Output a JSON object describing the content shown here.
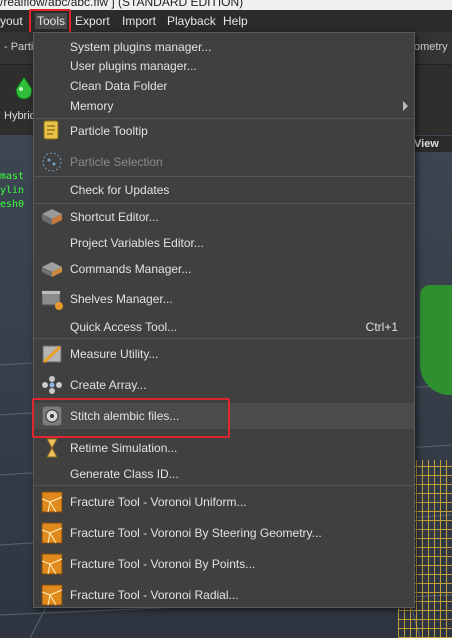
{
  "window": {
    "title": "/realflow/abc/abc.flw ] (STANDARD EDITION)"
  },
  "menubar": [
    {
      "label": "yout"
    },
    {
      "label": "Tools"
    },
    {
      "label": "Export"
    },
    {
      "label": "Import"
    },
    {
      "label": "Playback"
    },
    {
      "label": "Help"
    }
  ],
  "tabs": {
    "left": "- Parti",
    "right": "ometry"
  },
  "shelf": {
    "item": "Hybrid"
  },
  "viewport": {
    "label": "View"
  },
  "console": [
    "mast",
    "ylin",
    "esh0"
  ],
  "menu": {
    "items": [
      {
        "label": "System plugins manager..."
      },
      {
        "label": "User plugins manager..."
      },
      {
        "label": "Clean Data Folder"
      },
      {
        "label": "Memory"
      },
      {
        "label": "Particle Tooltip",
        "icon": "tooltip-icon"
      },
      {
        "label": "Particle Selection",
        "icon": "particle-selection-icon"
      },
      {
        "label": "Check for Updates"
      },
      {
        "label": "Shortcut Editor...",
        "icon": "keyboard-icon"
      },
      {
        "label": "Project Variables Editor..."
      },
      {
        "label": "Commands Manager...",
        "icon": "commands-icon"
      },
      {
        "label": "Shelves Manager...",
        "icon": "shelves-icon"
      },
      {
        "label": "Quick Access Tool...",
        "shortcut": "Ctrl+1"
      },
      {
        "label": "Measure Utility...",
        "icon": "measure-icon"
      },
      {
        "label": "Create Array...",
        "icon": "array-icon"
      },
      {
        "label": "Stitch alembic files...",
        "icon": "alembic-icon"
      },
      {
        "label": "Retime Simulation...",
        "icon": "hourglass-icon"
      },
      {
        "label": "Generate Class ID..."
      },
      {
        "label": "Fracture Tool - Voronoi Uniform...",
        "icon": "fracture-icon"
      },
      {
        "label": "Fracture Tool - Voronoi By Steering Geometry...",
        "icon": "fracture-icon"
      },
      {
        "label": "Fracture Tool - Voronoi By Points...",
        "icon": "fracture-icon"
      },
      {
        "label": "Fracture Tool - Voronoi Radial...",
        "icon": "fracture-icon"
      }
    ]
  },
  "colors": {
    "highlight_box": "#e0262d",
    "menu_bg": "#404040"
  }
}
